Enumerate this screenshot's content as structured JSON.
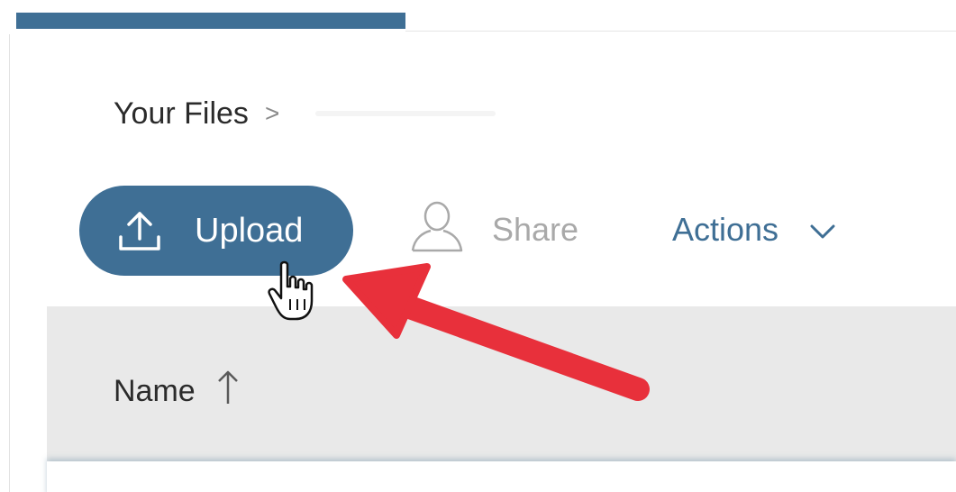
{
  "breadcrumb": {
    "root_label": "Your Files",
    "separator": ">"
  },
  "toolbar": {
    "upload_label": "Upload",
    "upload_icon": "upload-icon",
    "share_label": "Share",
    "share_icon": "user-outline-icon",
    "actions_label": "Actions",
    "actions_icon": "chevron-down-icon"
  },
  "table": {
    "columns": [
      {
        "label": "Name",
        "sort": "ascending",
        "sort_icon": "arrow-up-icon"
      }
    ]
  },
  "annotation": {
    "type": "red-arrow",
    "target": "upload-button",
    "color": "#e8303b"
  },
  "colors": {
    "accent": "#3f6f95",
    "header_background": "#e9e9e9",
    "muted_text": "#a9a9a9"
  }
}
